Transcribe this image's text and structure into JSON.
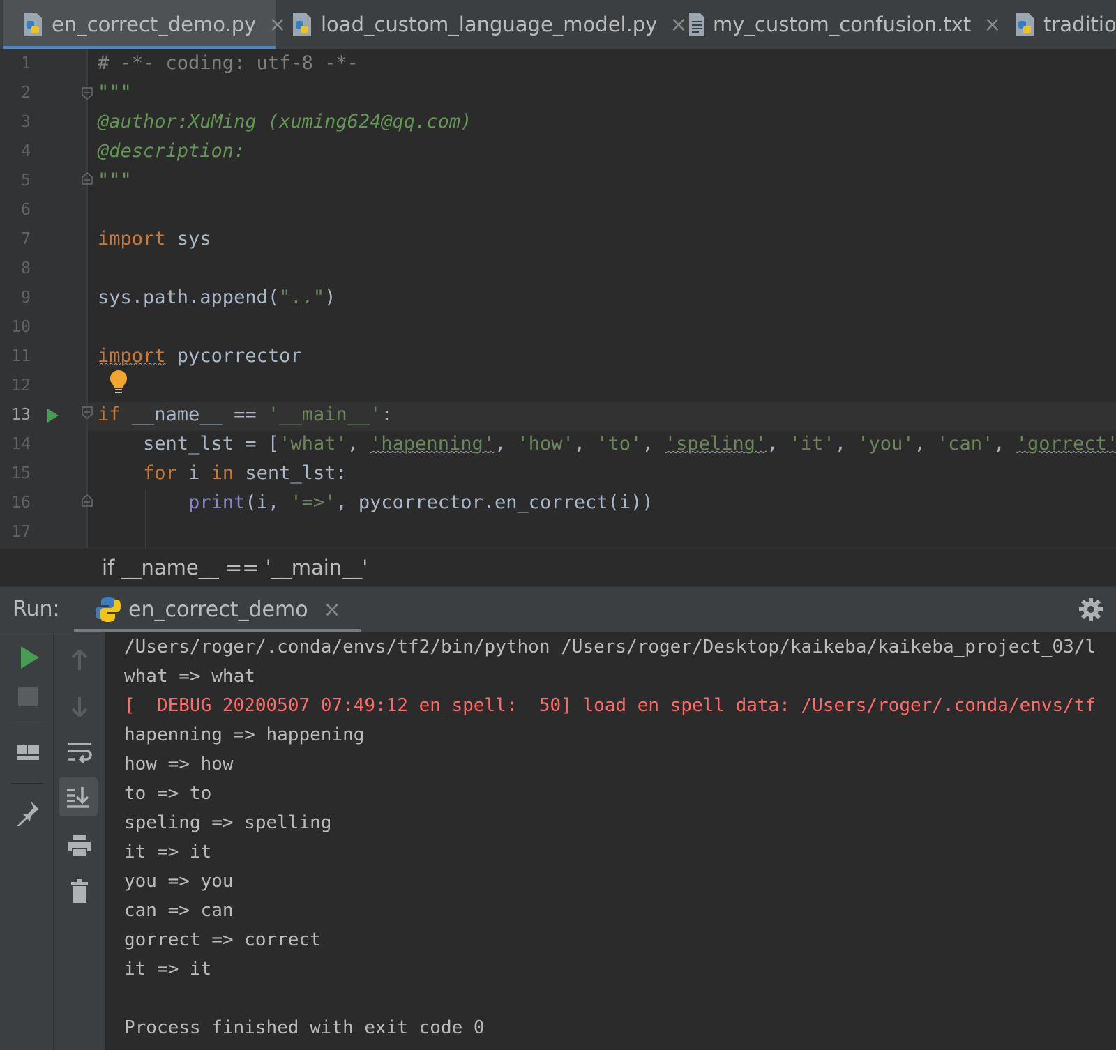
{
  "tabs": [
    {
      "label": "en_correct_demo.py",
      "icon": "python-file-icon",
      "active": true
    },
    {
      "label": "load_custom_language_model.py",
      "icon": "python-file-icon",
      "active": false
    },
    {
      "label": "my_custom_confusion.txt",
      "icon": "text-file-icon",
      "active": false
    },
    {
      "label": "traditior",
      "icon": "python-file-icon",
      "active": false
    }
  ],
  "editor": {
    "line_numbers": [
      "1",
      "2",
      "3",
      "4",
      "5",
      "6",
      "7",
      "8",
      "9",
      "10",
      "11",
      "12",
      "13",
      "14",
      "15",
      "16",
      "17"
    ],
    "current_line": "13",
    "lines": {
      "l1": "# -*- coding: utf-8 -*-",
      "l2": "\"\"\"",
      "l3": "@author:XuMing (xuming624@qq.com)",
      "l4": "@description:",
      "l5": "\"\"\"",
      "l7_kw": "import",
      "l7_rest": " sys",
      "l9_a": "sys.path.append(",
      "l9_str": "\"..\"",
      "l9_b": ")",
      "l11_kw": "import",
      "l11_rest": " pycorrector",
      "l13_kw": "if",
      "l13_a": " __name__ == ",
      "l13_str": "'__main__'",
      "l13_b": ":",
      "l14_a": "    sent_lst = [",
      "l14_s1": "'what'",
      "l14_s2": "'hapenning'",
      "l14_s3": "'how'",
      "l14_s4": "'to'",
      "l14_s5": "'speling'",
      "l14_s6": "'it'",
      "l14_s7": "'you'",
      "l14_s8": "'can'",
      "l14_s9": "'gorrect'",
      "l14_sep": ", ",
      "l14_end": ",",
      "l15_kw1": "for",
      "l15_a": " i ",
      "l15_kw2": "in",
      "l15_b": " sent_lst:",
      "l16_bi": "print",
      "l16_a": "(i, ",
      "l16_str": "'=>'",
      "l16_b": ", pycorrector.en_correct(i))"
    }
  },
  "breadcrumb": "if __name__ == '__main__'",
  "run": {
    "label": "Run:",
    "tab_label": "en_correct_demo",
    "output": [
      {
        "text": "/Users/roger/.conda/envs/tf2/bin/python /Users/roger/Desktop/kaikeba/kaikeba_project_03/l",
        "type": "normal"
      },
      {
        "text": "what => what",
        "type": "normal"
      },
      {
        "text": "[  DEBUG 20200507 07:49:12 en_spell:  50] load en spell data: /Users/roger/.conda/envs/tf",
        "type": "error"
      },
      {
        "text": "hapenning => happening",
        "type": "normal"
      },
      {
        "text": "how => how",
        "type": "normal"
      },
      {
        "text": "to => to",
        "type": "normal"
      },
      {
        "text": "speling => spelling",
        "type": "normal"
      },
      {
        "text": "it => it",
        "type": "normal"
      },
      {
        "text": "you => you",
        "type": "normal"
      },
      {
        "text": "can => can",
        "type": "normal"
      },
      {
        "text": "gorrect => correct",
        "type": "normal"
      },
      {
        "text": "it => it",
        "type": "normal"
      },
      {
        "text": "",
        "type": "normal"
      },
      {
        "text": "Process finished with exit code 0",
        "type": "normal"
      }
    ]
  },
  "colors": {
    "keyword": "#cc7832",
    "string": "#6a8759",
    "docstring": "#629755",
    "comment": "#808080",
    "builtin": "#8888c6",
    "error_output": "#ff6b68",
    "run_green": "#499c54"
  }
}
